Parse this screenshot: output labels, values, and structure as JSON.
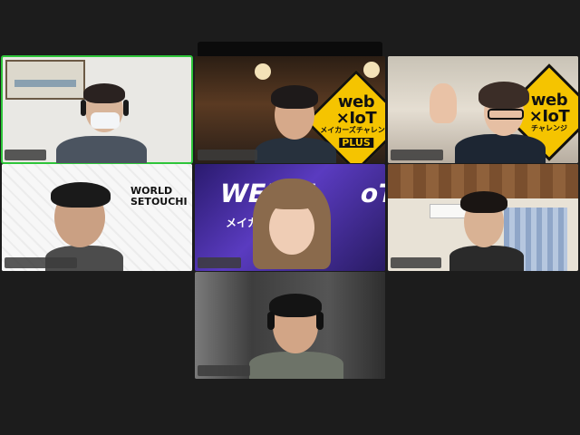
{
  "participants": [
    {
      "name": ""
    },
    {
      "name": ""
    },
    {
      "name": ""
    },
    {
      "name": ""
    },
    {
      "name": ""
    },
    {
      "name": ""
    },
    {
      "name": ""
    }
  ],
  "signs": {
    "top_line": "web",
    "mid_line": "×IoT",
    "sub_line": "メイカーズチャレンジ",
    "plus_line": "PLUS",
    "sub_line_short": "チャレンジ"
  },
  "backgrounds": {
    "doodle_title_1": "WORLD",
    "doodle_title_2": "SETOUCHI",
    "banner_text_1": "WEB×I",
    "banner_text_2": "oT",
    "banner_sub": "メイカ"
  },
  "colors": {
    "active_speaker": "#2ec53a",
    "sign_yellow": "#f5c400",
    "background": "#1c1c1c",
    "banner_purple": "#4b2fa5"
  }
}
